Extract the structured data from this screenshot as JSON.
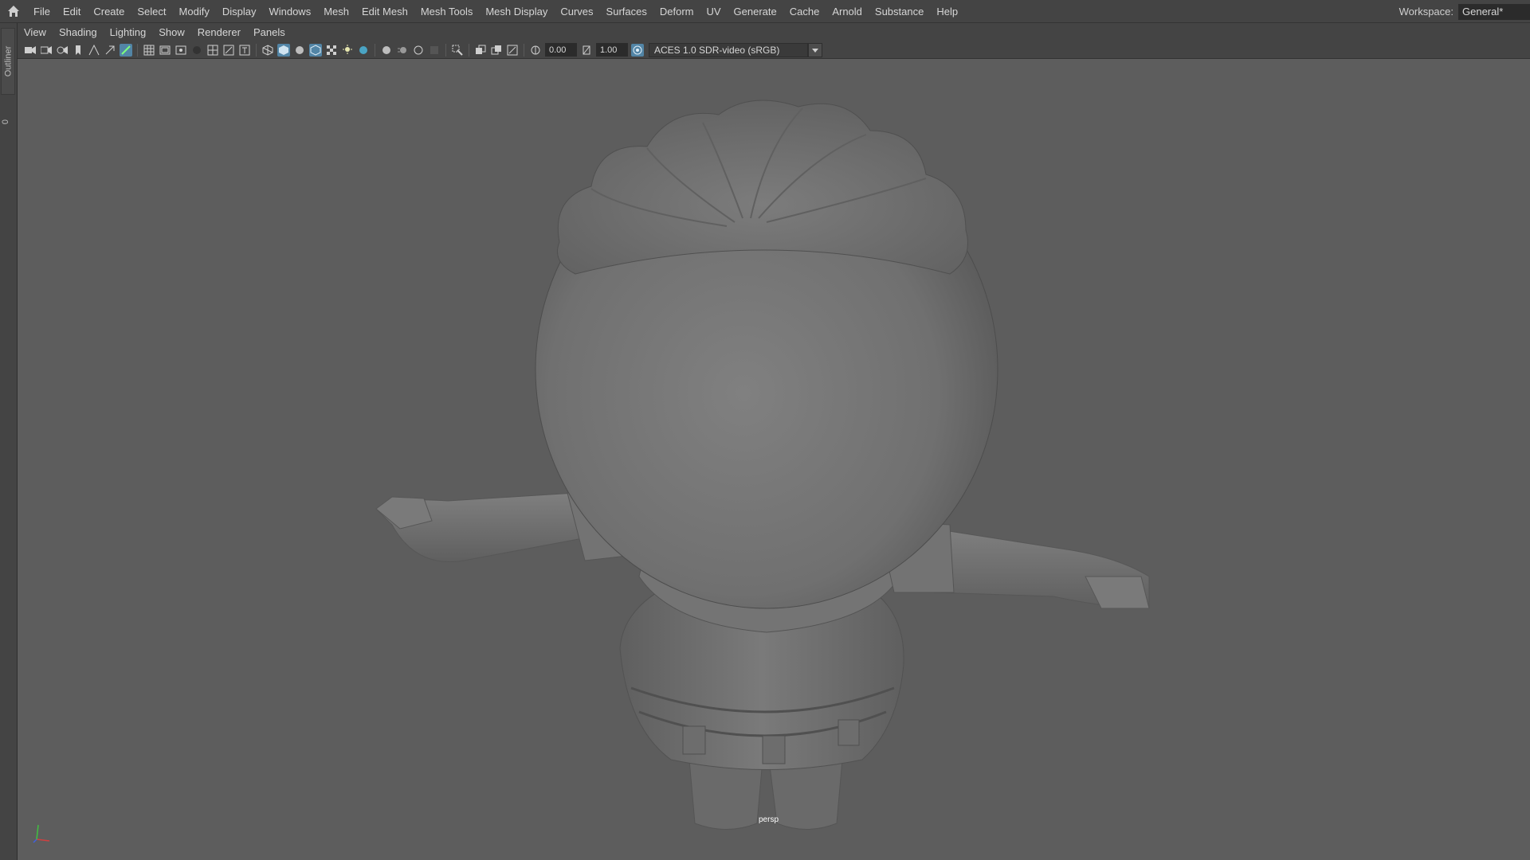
{
  "menubar": {
    "home_icon": "home-icon",
    "items": [
      "File",
      "Edit",
      "Create",
      "Select",
      "Modify",
      "Display",
      "Windows",
      "Mesh",
      "Edit Mesh",
      "Mesh Tools",
      "Mesh Display",
      "Curves",
      "Surfaces",
      "Deform",
      "UV",
      "Generate",
      "Cache",
      "Arnold",
      "Substance",
      "Help"
    ],
    "workspace_label": "Workspace:",
    "workspace_value": "General*"
  },
  "left_strip": {
    "outliner_label": "Outliner",
    "count": "0"
  },
  "panel_menu": {
    "items": [
      "View",
      "Shading",
      "Lighting",
      "Show",
      "Renderer",
      "Panels"
    ]
  },
  "viewport_toolbar": {
    "exposure_value": "0.00",
    "gamma_value": "1.00",
    "color_space": "ACES 1.0 SDR-video (sRGB)"
  },
  "viewport": {
    "camera_label": "persp",
    "colors": {
      "background": "#5d5d5d",
      "model": "#7a7a7a",
      "axis_x": "#d04040",
      "axis_y": "#40c040",
      "axis_z": "#4060e0"
    }
  }
}
